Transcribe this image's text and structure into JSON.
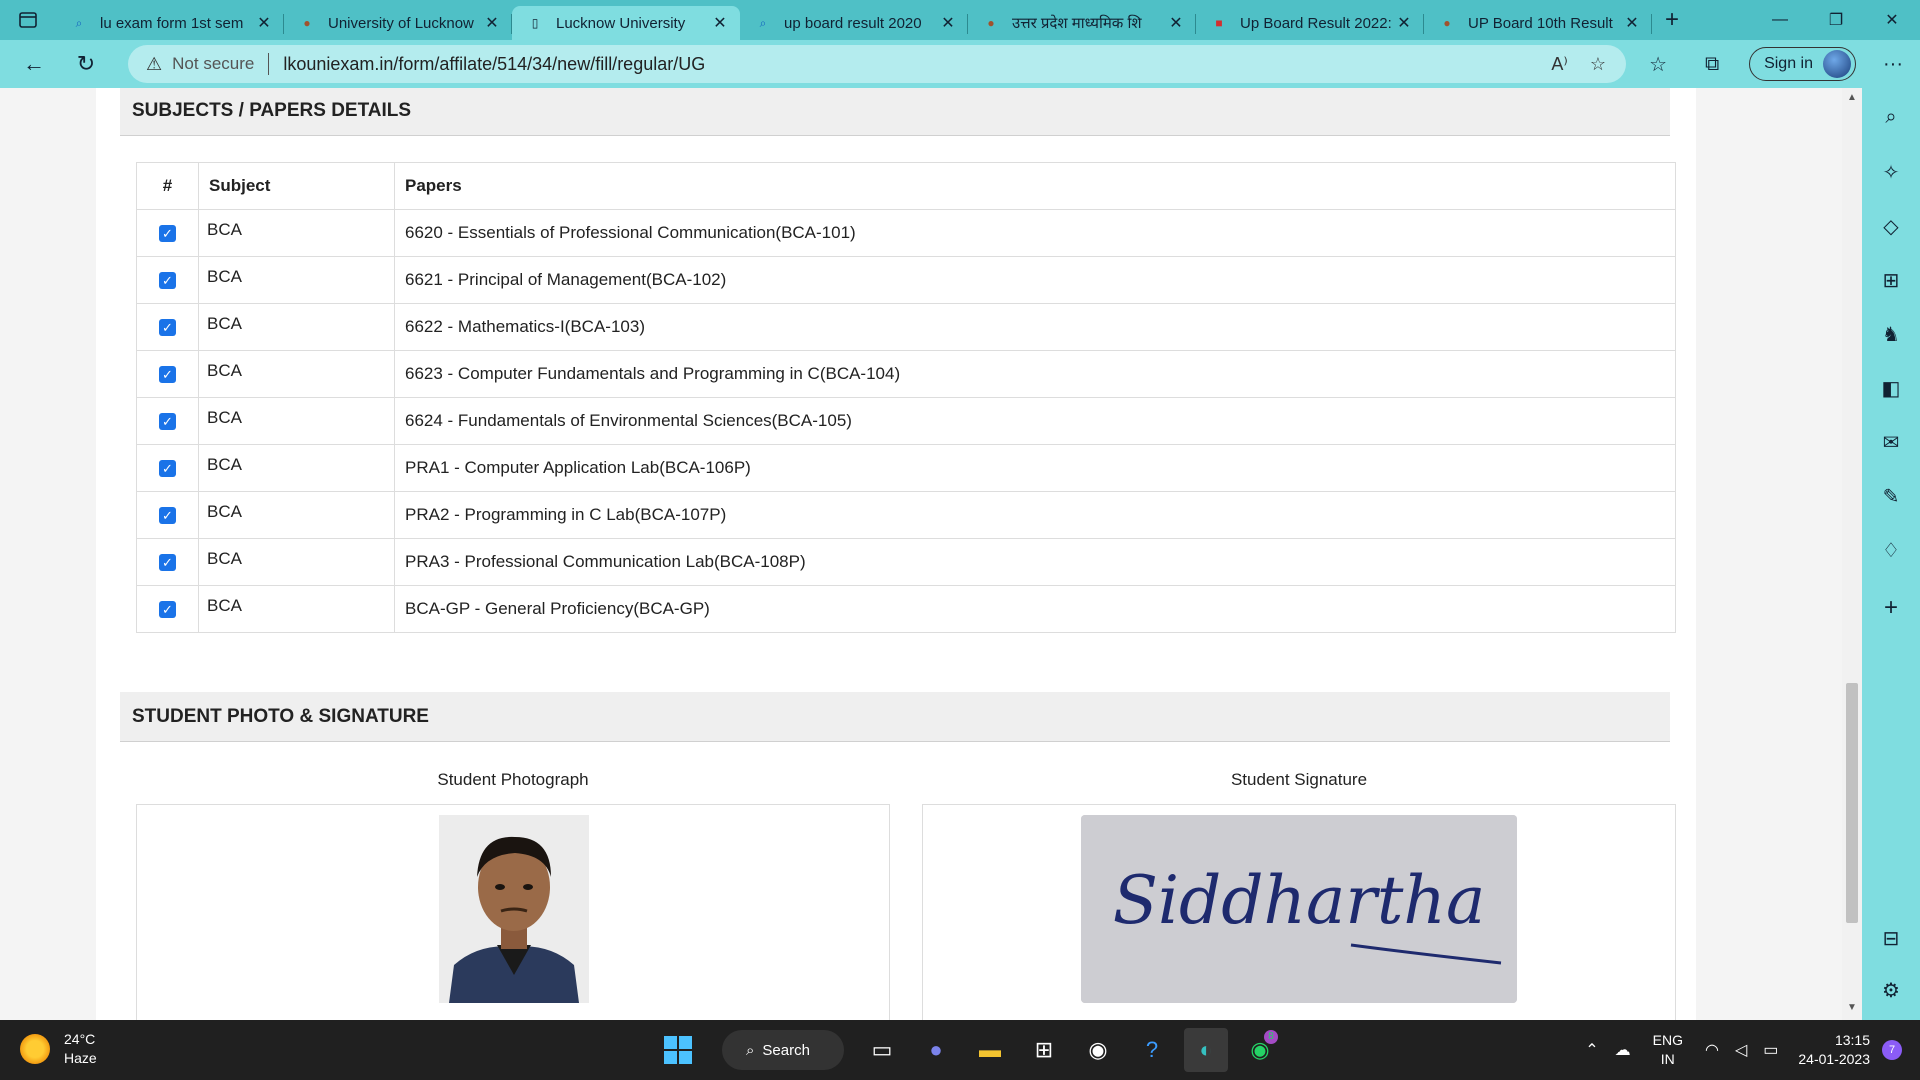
{
  "tabs": [
    {
      "label": "lu exam form 1st sem",
      "icon": "search-icon"
    },
    {
      "label": "University of Lucknow",
      "icon": "university-icon"
    },
    {
      "label": "Lucknow University",
      "icon": "page-icon",
      "active": true
    },
    {
      "label": "up board result 2020",
      "icon": "search-icon"
    },
    {
      "label": "उत्तर प्रदेश माध्यमिक शि",
      "icon": "board-icon"
    },
    {
      "label": "Up Board Result 2022:",
      "icon": "news-icon"
    },
    {
      "label": "UP Board 10th Result",
      "icon": "board-icon"
    }
  ],
  "address": {
    "security": "Not secure",
    "url": "lkouniexam.in/form/affilate/514/34/new/fill/regular/UG"
  },
  "toolbar": {
    "signin": "Sign in"
  },
  "subjects": {
    "heading": "SUBJECTS / PAPERS DETAILS",
    "columns": [
      "#",
      "Subject",
      "Papers"
    ],
    "rows": [
      {
        "subject": "BCA",
        "paper": "6620 - Essentials of Professional Communication(BCA-101)"
      },
      {
        "subject": "BCA",
        "paper": "6621 - Principal of Management(BCA-102)"
      },
      {
        "subject": "BCA",
        "paper": "6622 - Mathematics-I(BCA-103)"
      },
      {
        "subject": "BCA",
        "paper": "6623 - Computer Fundamentals and Programming in C(BCA-104)"
      },
      {
        "subject": "BCA",
        "paper": "6624 - Fundamentals of Environmental Sciences(BCA-105)"
      },
      {
        "subject": "BCA",
        "paper": "PRA1 - Computer Application Lab(BCA-106P)"
      },
      {
        "subject": "BCA",
        "paper": "PRA2 - Programming in C Lab(BCA-107P)"
      },
      {
        "subject": "BCA",
        "paper": "PRA3 - Professional Communication Lab(BCA-108P)"
      },
      {
        "subject": "BCA",
        "paper": "BCA-GP - General Proficiency(BCA-GP)"
      }
    ]
  },
  "photo": {
    "heading": "STUDENT PHOTO & SIGNATURE",
    "photo_label": "Student Photograph",
    "signature_label": "Student Signature",
    "signature_text": "Siddhartha"
  },
  "taskbar": {
    "temp": "24°C",
    "weather": "Haze",
    "search": "Search",
    "lang1": "ENG",
    "lang2": "IN",
    "time": "13:15",
    "date": "24-01-2023",
    "whatsapp_badge": "8",
    "notif_count": "7"
  }
}
